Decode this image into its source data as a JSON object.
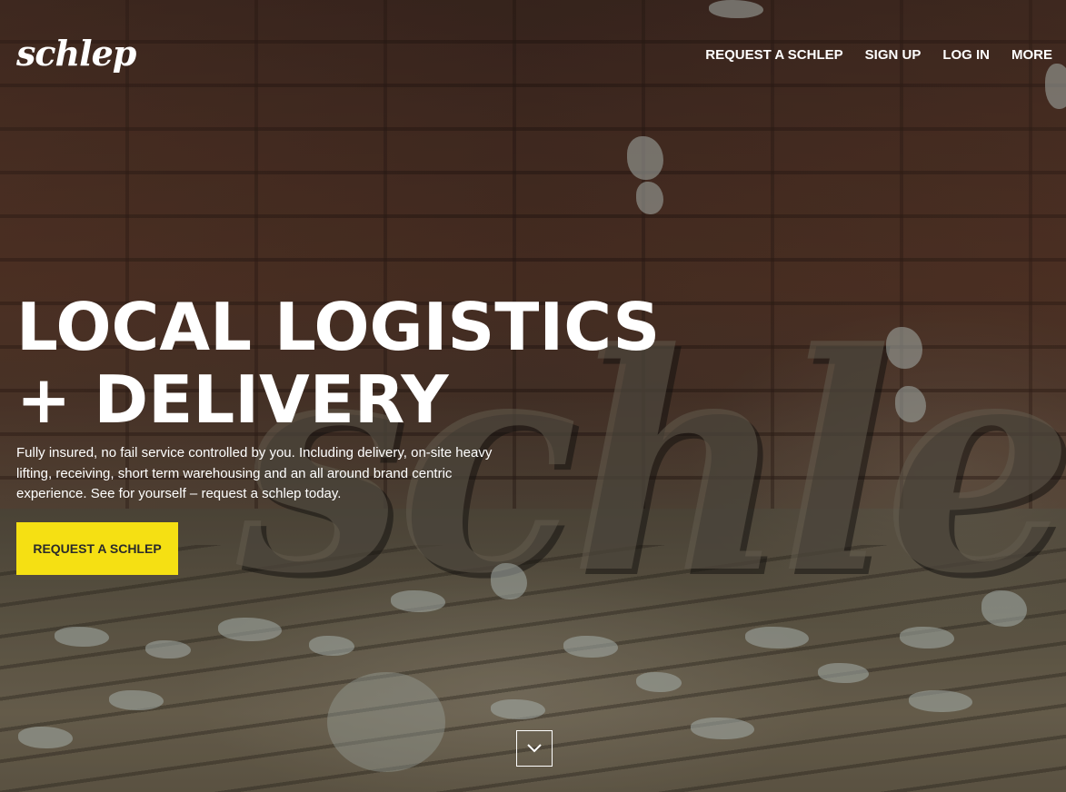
{
  "brand": {
    "logo_text": "schlep"
  },
  "nav": {
    "items": [
      {
        "label": "REQUEST A SCHLEP"
      },
      {
        "label": "SIGN UP"
      },
      {
        "label": "LOG IN"
      },
      {
        "label": "MORE"
      }
    ]
  },
  "hero": {
    "headline_line1": "LOCAL LOGISTICS",
    "headline_line2": "+ DELIVERY",
    "description": "Fully insured, no fail service controlled by you. Including delivery, on-site heavy lifting, receiving, short term warehousing and an all around brand centric experience. See for yourself – request a schlep today.",
    "cta_label": "REQUEST A SCHLEP",
    "background_letters": "schlep"
  },
  "scroll": {
    "icon": "chevron-down-icon"
  },
  "colors": {
    "accent": "#f5e013",
    "text": "#ffffff"
  }
}
